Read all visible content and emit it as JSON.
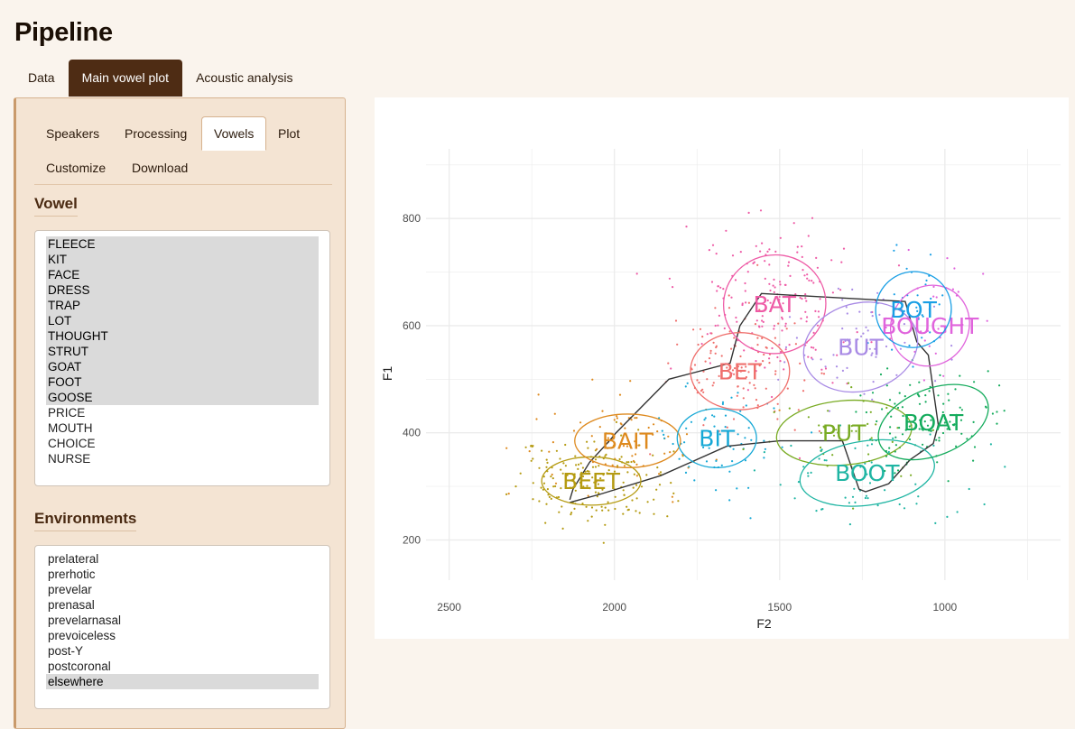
{
  "app": {
    "title": "Pipeline"
  },
  "main_tabs": [
    {
      "label": "Data",
      "active": false
    },
    {
      "label": "Main vowel plot",
      "active": true
    },
    {
      "label": "Acoustic analysis",
      "active": false
    }
  ],
  "sub_tabs": [
    {
      "label": "Speakers",
      "active": false
    },
    {
      "label": "Processing",
      "active": false
    },
    {
      "label": "Vowels",
      "active": true
    },
    {
      "label": "Plot",
      "active": false
    },
    {
      "label": "Customize",
      "active": false
    },
    {
      "label": "Download",
      "active": false
    }
  ],
  "vowel_section": {
    "title": "Vowel",
    "options": [
      {
        "label": "FLEECE",
        "selected": true
      },
      {
        "label": "KIT",
        "selected": true
      },
      {
        "label": "FACE",
        "selected": true
      },
      {
        "label": "DRESS",
        "selected": true
      },
      {
        "label": "TRAP",
        "selected": true
      },
      {
        "label": "LOT",
        "selected": true
      },
      {
        "label": "THOUGHT",
        "selected": true
      },
      {
        "label": "STRUT",
        "selected": true
      },
      {
        "label": "GOAT",
        "selected": true
      },
      {
        "label": "FOOT",
        "selected": true
      },
      {
        "label": "GOOSE",
        "selected": true
      },
      {
        "label": "PRICE",
        "selected": false
      },
      {
        "label": "MOUTH",
        "selected": false
      },
      {
        "label": "CHOICE",
        "selected": false
      },
      {
        "label": "NURSE",
        "selected": false
      }
    ]
  },
  "environments_section": {
    "title": "Environments",
    "options": [
      {
        "label": "prelateral",
        "selected": false
      },
      {
        "label": "prerhotic",
        "selected": false
      },
      {
        "label": "prevelar",
        "selected": false
      },
      {
        "label": "prenasal",
        "selected": false
      },
      {
        "label": "prevelarnasal",
        "selected": false
      },
      {
        "label": "prevoiceless",
        "selected": false
      },
      {
        "label": "post-Y",
        "selected": false
      },
      {
        "label": "postcoronal",
        "selected": false
      },
      {
        "label": "elsewhere",
        "selected": true
      }
    ]
  },
  "chart_data": {
    "type": "scatter",
    "title": "",
    "xlabel": "F2",
    "ylabel": "F1",
    "xlim": [
      2570,
      650
    ],
    "ylim": [
      930,
      125
    ],
    "x_reversed": true,
    "y_reversed": true,
    "x_ticks": [
      2500,
      2000,
      1500,
      1000
    ],
    "y_ticks": [
      200,
      400,
      600,
      800
    ],
    "grid": true,
    "legend": "none",
    "series": [
      {
        "name": "BEET",
        "color": "#b59b12",
        "mean": [
          2070,
          310
        ],
        "sd": [
          110,
          40
        ],
        "ellipse": [
          150,
          45,
          0
        ],
        "n": 170
      },
      {
        "name": "BAIT",
        "color": "#de8a1f",
        "mean": [
          1960,
          385
        ],
        "sd": [
          120,
          45
        ],
        "ellipse": [
          160,
          50,
          0
        ],
        "n": 70
      },
      {
        "name": "BIT",
        "color": "#16a8d6",
        "mean": [
          1690,
          390
        ],
        "sd": [
          90,
          40
        ],
        "ellipse": [
          120,
          55,
          0
        ],
        "n": 60
      },
      {
        "name": "BET",
        "color": "#ef6f6c",
        "mean": [
          1620,
          515
        ],
        "sd": [
          110,
          55
        ],
        "ellipse": [
          150,
          72,
          0
        ],
        "n": 110
      },
      {
        "name": "BAT",
        "color": "#ee5ba6",
        "mean": [
          1515,
          640
        ],
        "sd": [
          120,
          65
        ],
        "ellipse": [
          155,
          92,
          -12
        ],
        "n": 170
      },
      {
        "name": "BUT",
        "color": "#a98be5",
        "mean": [
          1255,
          560
        ],
        "sd": [
          120,
          60
        ],
        "ellipse": [
          175,
          82,
          -15
        ],
        "n": 60
      },
      {
        "name": "PUT",
        "color": "#79ab23",
        "mean": [
          1305,
          400
        ],
        "sd": [
          130,
          45
        ],
        "ellipse": [
          205,
          60,
          -5
        ],
        "n": 40
      },
      {
        "name": "BOOT",
        "color": "#1fb5a3",
        "mean": [
          1235,
          325
        ],
        "sd": [
          130,
          45
        ],
        "ellipse": [
          205,
          60,
          -8
        ],
        "n": 60
      },
      {
        "name": "BOAT",
        "color": "#14ab5c",
        "mean": [
          1035,
          420
        ],
        "sd": [
          90,
          45
        ],
        "ellipse": [
          175,
          62,
          -22
        ],
        "n": 110
      },
      {
        "name": "BOUGHT",
        "color": "#e064dc",
        "mean": [
          1045,
          600
        ],
        "sd": [
          70,
          60
        ],
        "ellipse": [
          125,
          72,
          -55
        ],
        "n": 30
      },
      {
        "name": "BOT",
        "color": "#1a9fe5",
        "mean": [
          1095,
          630
        ],
        "sd": [
          55,
          60
        ],
        "ellipse": [
          116,
          70,
          -52
        ],
        "n": 30
      }
    ],
    "trajectory": [
      [
        2135,
        275
      ],
      [
        2125,
        295
      ],
      [
        2075,
        345
      ],
      [
        2015,
        385
      ],
      [
        1995,
        400
      ],
      [
        1835,
        500
      ],
      [
        1650,
        530
      ],
      [
        1620,
        600
      ],
      [
        1555,
        660
      ],
      [
        1120,
        645
      ],
      [
        1085,
        570
      ],
      [
        1050,
        545
      ],
      [
        1020,
        415
      ],
      [
        1035,
        380
      ],
      [
        1105,
        350
      ],
      [
        1170,
        305
      ],
      [
        1240,
        290
      ],
      [
        1260,
        295
      ],
      [
        1310,
        385
      ],
      [
        1500,
        385
      ],
      [
        1660,
        375
      ],
      [
        1860,
        320
      ],
      [
        2045,
        285
      ],
      [
        2135,
        270
      ]
    ]
  }
}
